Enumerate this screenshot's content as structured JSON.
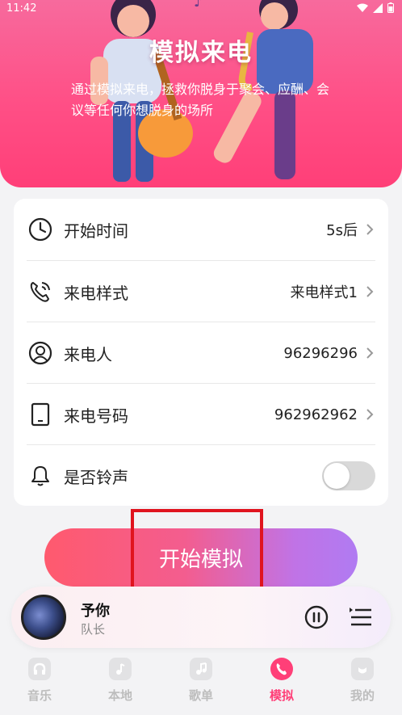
{
  "status_bar": {
    "time": "11:42"
  },
  "banner": {
    "title": "模拟来电",
    "description": "通过模拟来电，拯救你脱身于聚会、应酬、会议等任何你想脱身的场所"
  },
  "settings": {
    "start_time": {
      "label": "开始时间",
      "value": "5s后",
      "icon": "clock-icon"
    },
    "call_style": {
      "label": "来电样式",
      "value": "来电样式1",
      "icon": "phone-call-icon"
    },
    "caller": {
      "label": "来电人",
      "value": "96296296",
      "icon": "person-icon"
    },
    "caller_number": {
      "label": "来电号码",
      "value": "962962962",
      "icon": "tablet-icon"
    },
    "ringtone": {
      "label": "是否铃声",
      "enabled": false,
      "icon": "bell-icon"
    }
  },
  "start_button": {
    "label": "开始模拟"
  },
  "player": {
    "title": "予你",
    "artist": "队长",
    "state": "playing"
  },
  "tabs": [
    {
      "label": "音乐",
      "icon": "headphones-icon",
      "active": false
    },
    {
      "label": "本地",
      "icon": "music-note-icon",
      "active": false
    },
    {
      "label": "歌单",
      "icon": "playlist-icon",
      "active": false
    },
    {
      "label": "模拟",
      "icon": "phone-icon",
      "active": true
    },
    {
      "label": "我的",
      "icon": "profile-icon",
      "active": false
    }
  ],
  "colors": {
    "accent": "#ff3f78",
    "banner_start": "#f76a9d",
    "button_gradient_start": "#ff5a6e",
    "button_gradient_end": "#b07bf2",
    "highlight_box": "#e0141e"
  }
}
